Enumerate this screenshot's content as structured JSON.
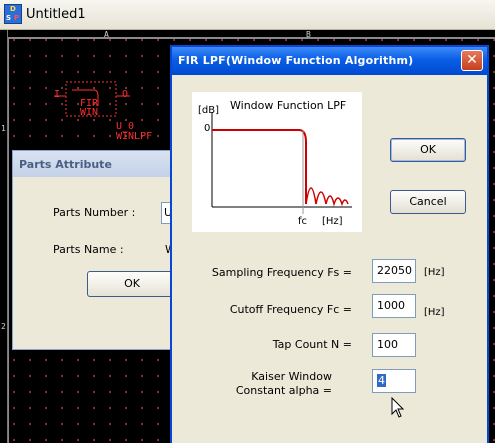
{
  "app": {
    "title": "Untitled1",
    "icon_letters": {
      "top": "D",
      "left": "S",
      "right": "P"
    }
  },
  "canvas": {
    "ruler_columns": [
      "A",
      "B"
    ],
    "ruler_rows": [
      "1",
      "2"
    ],
    "part": {
      "label_top": "FIR",
      "label_bottom": "WIN",
      "pin_in": "I",
      "pin_out": "O",
      "ref": "U_0",
      "name": "WINLPF"
    }
  },
  "parts_dialog": {
    "title": "Parts Attribute",
    "number_label": "Parts Number :",
    "number_value": "U",
    "name_label": "Parts Name :",
    "name_value": "W",
    "ok_label": "OK"
  },
  "fir_dialog": {
    "title": "FIR LPF(Window Function Algorithm)",
    "close_icon": "close-icon",
    "graph": {
      "title": "Window Function LPF",
      "y_unit": "[dB]",
      "y_zero": "0",
      "x_marker": "fc",
      "x_unit": "[Hz]"
    },
    "ok_label": "OK",
    "cancel_label": "Cancel",
    "fields": [
      {
        "label": "Sampling Frequency Fs =",
        "value": "22050",
        "unit": "[Hz]"
      },
      {
        "label": "Cutoff Frequency Fc =",
        "value": "1000",
        "unit": "[Hz]"
      },
      {
        "label": "Tap Count N =",
        "value": "100",
        "unit": ""
      },
      {
        "label_line1": "Kaiser Window",
        "label_line2": "Constant alpha =",
        "value": "4",
        "unit": ""
      }
    ]
  },
  "colors": {
    "title_bar": "#0a5ee6",
    "schematic": "#ff3030",
    "filter_curve": "#cc0000"
  }
}
